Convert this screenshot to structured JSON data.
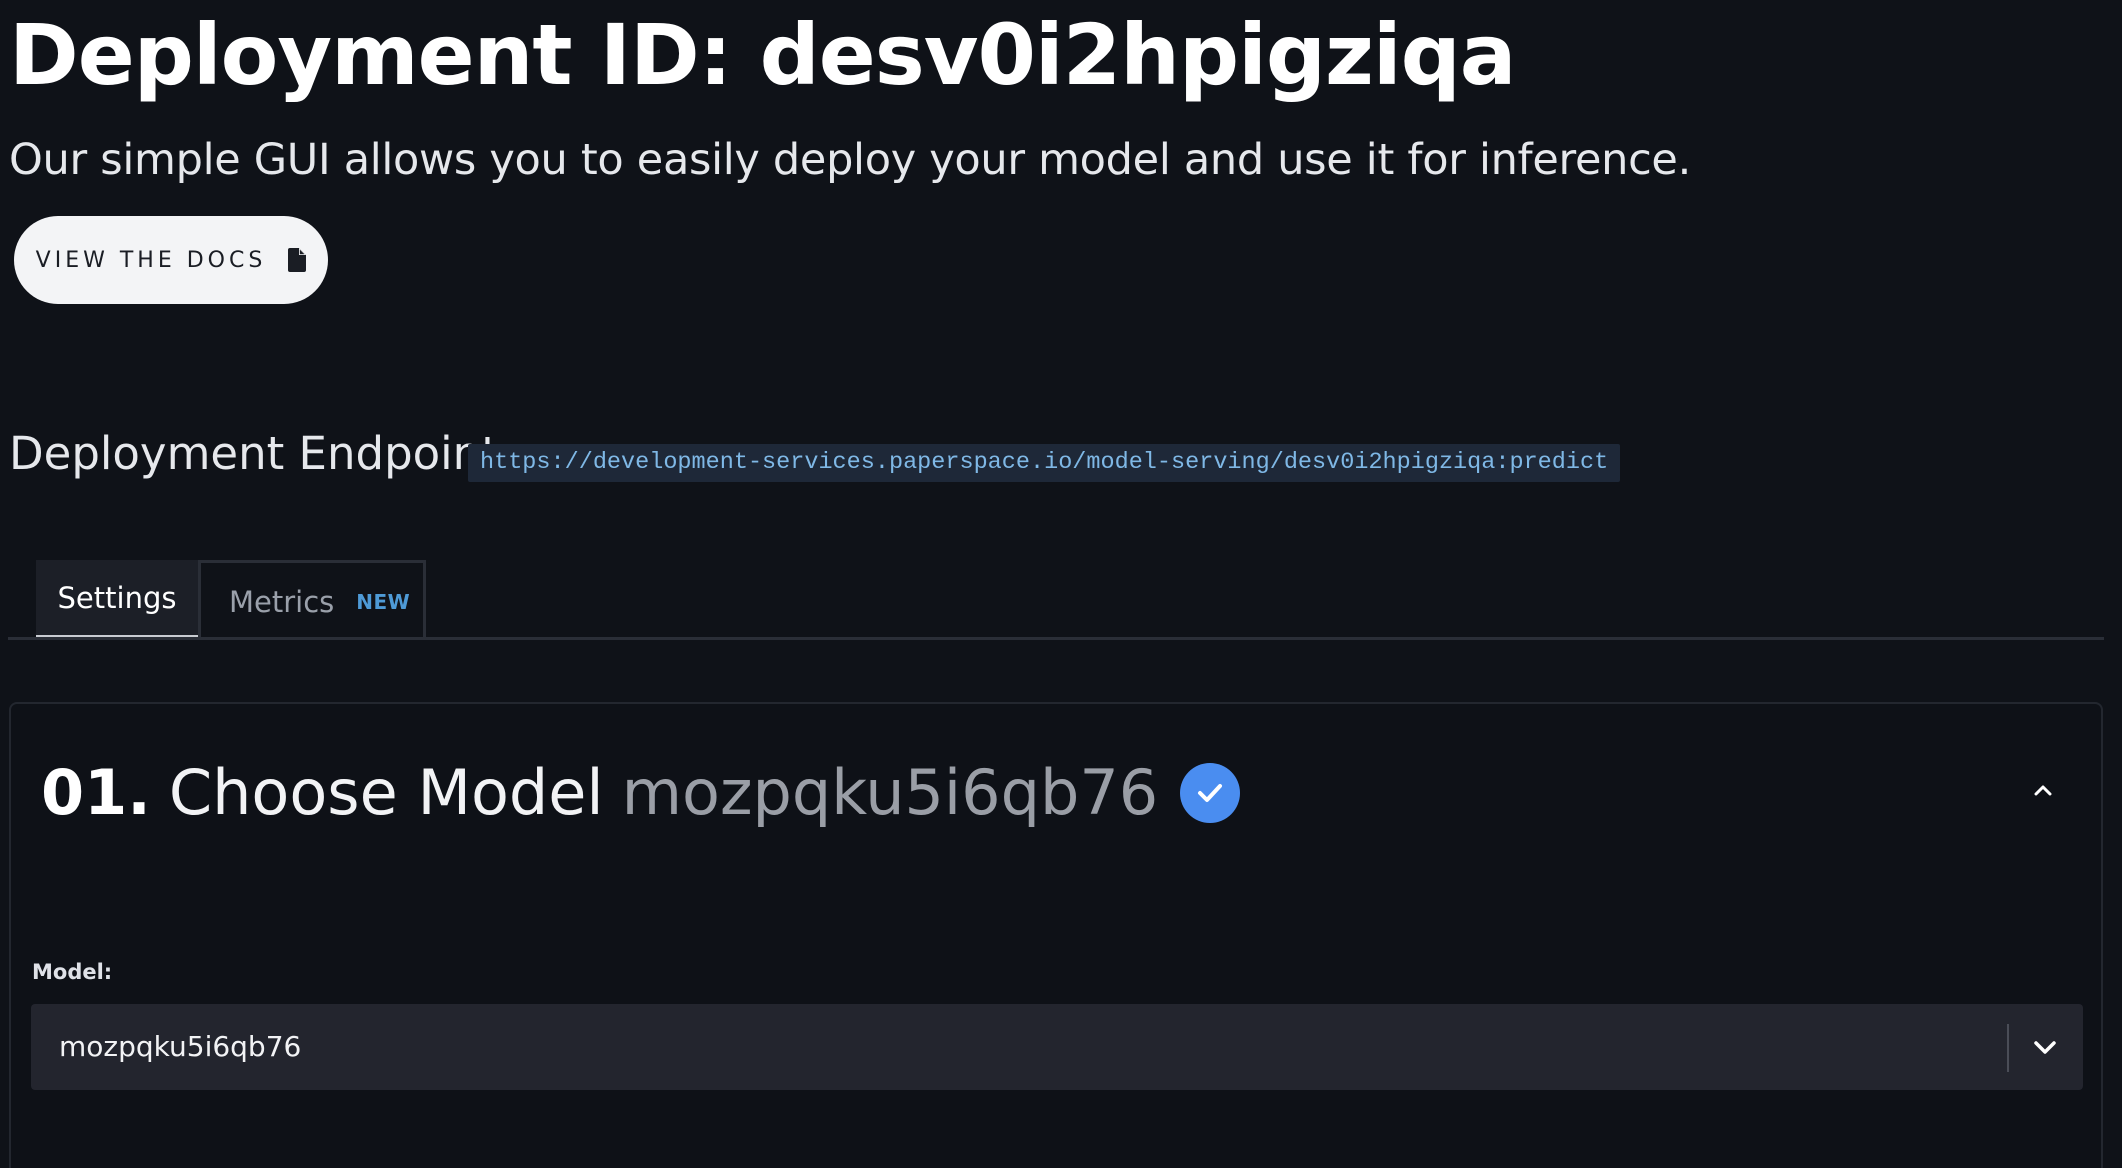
{
  "header": {
    "title": "Deployment ID: desv0i2hpigziqa",
    "subtitle": "Our simple GUI allows you to easily deploy your model and use it for inference.",
    "docs_button_label": "VIEW THE DOCS",
    "docs_icon": "document-icon"
  },
  "endpoint": {
    "label": "Deployment Endpoint:",
    "url": "https://development-services.paperspace.io/model-serving/desv0i2hpigziqa:predict"
  },
  "tabs": [
    {
      "label": "Settings",
      "active": true,
      "badge": ""
    },
    {
      "label": "Metrics",
      "active": false,
      "badge": "NEW"
    }
  ],
  "step": {
    "number": "01.",
    "title": "Choose Model",
    "model_id": "mozpqku5i6qb76",
    "status_icon": "check-circle-icon",
    "collapse_icon": "chevron-up-icon"
  },
  "model_field": {
    "label": "Model:",
    "value": "mozpqku5i6qb76",
    "dropdown_icon": "chevron-down-icon"
  },
  "colors": {
    "background": "#0f1218",
    "accent_blue": "#4a8df0",
    "badge_blue": "#4e9ad6",
    "code_text": "#7fb8e6",
    "code_bg": "#1e2838"
  }
}
